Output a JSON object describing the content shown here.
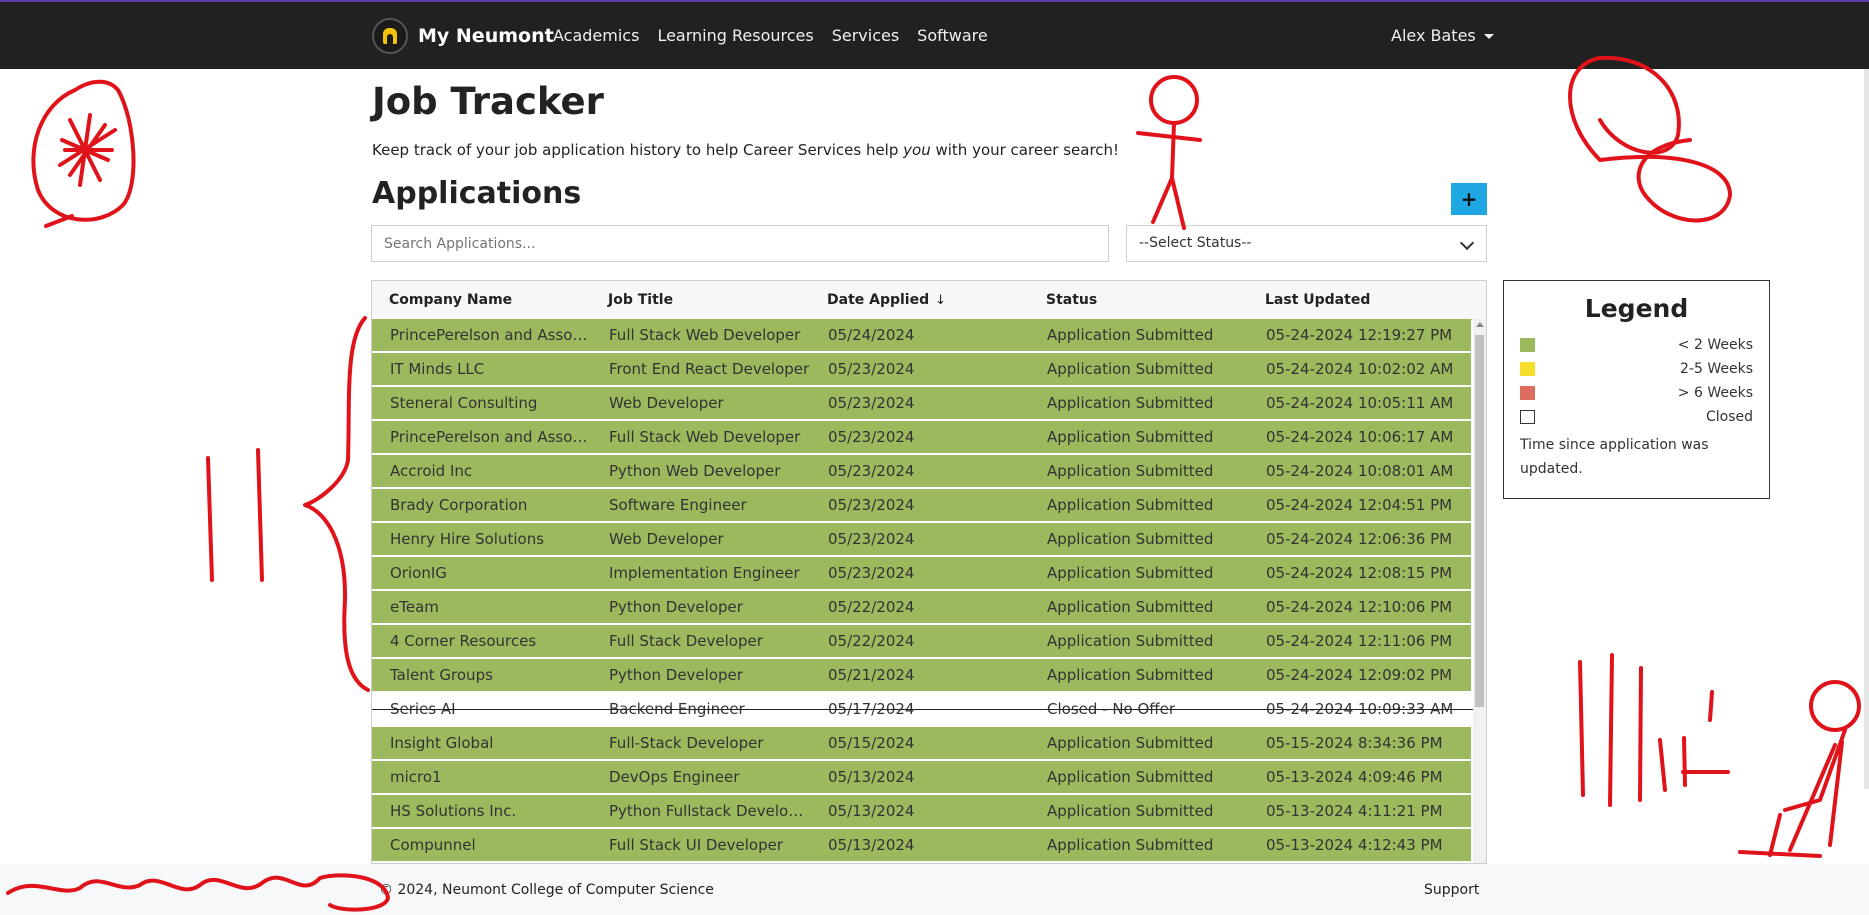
{
  "nav": {
    "brand": "My Neumont",
    "links": [
      "Academics",
      "Learning Resources",
      "Services",
      "Software"
    ],
    "user": "Alex Bates"
  },
  "header": {
    "title": "Job Tracker",
    "subtitle_before": "Keep track of your job application history to help Career Services help ",
    "subtitle_em": "you",
    "subtitle_after": " with your career search!"
  },
  "applications": {
    "heading": "Applications",
    "add_label": "+",
    "search_placeholder": "Search Applications...",
    "status_select": "--Select Status--",
    "sort_arrow": "↓",
    "columns": [
      "Company Name",
      "Job Title",
      "Date Applied",
      "Status",
      "Last Updated"
    ],
    "rows": [
      {
        "company": "PrincePerelson and Associates",
        "title": "Full Stack Web Developer",
        "date": "05/24/2024",
        "status": "Application Submitted",
        "updated": "05-24-2024 12:19:27 PM",
        "closed": false
      },
      {
        "company": "IT Minds LLC",
        "title": "Front End React Developer",
        "date": "05/23/2024",
        "status": "Application Submitted",
        "updated": "05-24-2024 10:02:02 AM",
        "closed": false
      },
      {
        "company": "Steneral Consulting",
        "title": "Web Developer",
        "date": "05/23/2024",
        "status": "Application Submitted",
        "updated": "05-24-2024 10:05:11 AM",
        "closed": false
      },
      {
        "company": "PrincePerelson and Associates",
        "title": "Full Stack Web Developer",
        "date": "05/23/2024",
        "status": "Application Submitted",
        "updated": "05-24-2024 10:06:17 AM",
        "closed": false
      },
      {
        "company": "Accroid Inc",
        "title": "Python Web Developer",
        "date": "05/23/2024",
        "status": "Application Submitted",
        "updated": "05-24-2024 10:08:01 AM",
        "closed": false
      },
      {
        "company": "Brady Corporation",
        "title": "Software Engineer",
        "date": "05/23/2024",
        "status": "Application Submitted",
        "updated": "05-24-2024 12:04:51 PM",
        "closed": false
      },
      {
        "company": "Henry Hire Solutions",
        "title": "Web Developer",
        "date": "05/23/2024",
        "status": "Application Submitted",
        "updated": "05-24-2024 12:06:36 PM",
        "closed": false
      },
      {
        "company": "OrionIG",
        "title": "Implementation Engineer",
        "date": "05/23/2024",
        "status": "Application Submitted",
        "updated": "05-24-2024 12:08:15 PM",
        "closed": false
      },
      {
        "company": "eTeam",
        "title": "Python Developer",
        "date": "05/22/2024",
        "status": "Application Submitted",
        "updated": "05-24-2024 12:10:06 PM",
        "closed": false
      },
      {
        "company": "4 Corner Resources",
        "title": "Full Stack Developer",
        "date": "05/22/2024",
        "status": "Application Submitted",
        "updated": "05-24-2024 12:11:06 PM",
        "closed": false
      },
      {
        "company": "Talent Groups",
        "title": "Python Developer",
        "date": "05/21/2024",
        "status": "Application Submitted",
        "updated": "05-24-2024 12:09:02 PM",
        "closed": false
      },
      {
        "company": "Series AI",
        "title": "Backend Engineer",
        "date": "05/17/2024",
        "status": "Closed - No Offer",
        "updated": "05-24-2024 10:09:33 AM",
        "closed": true
      },
      {
        "company": "Insight Global",
        "title": "Full-Stack Developer",
        "date": "05/15/2024",
        "status": "Application Submitted",
        "updated": "05-15-2024 8:34:36 PM",
        "closed": false
      },
      {
        "company": "micro1",
        "title": "DevOps Engineer",
        "date": "05/13/2024",
        "status": "Application Submitted",
        "updated": "05-13-2024 4:09:46 PM",
        "closed": false
      },
      {
        "company": "HS Solutions Inc.",
        "title": "Python Fullstack Developer",
        "date": "05/13/2024",
        "status": "Application Submitted",
        "updated": "05-13-2024 4:11:21 PM",
        "closed": false
      },
      {
        "company": "Compunnel",
        "title": "Full Stack UI Developer",
        "date": "05/13/2024",
        "status": "Application Submitted",
        "updated": "05-13-2024 4:12:43 PM",
        "closed": false
      }
    ]
  },
  "legend": {
    "title": "Legend",
    "items": [
      {
        "label": "< 2 Weeks",
        "color": "#9cb95e"
      },
      {
        "label": "2-5 Weeks",
        "color": "#f6df2a"
      },
      {
        "label": "> 6 Weeks",
        "color": "#dd6e5f"
      },
      {
        "label": "Closed",
        "color": "#ffffff"
      }
    ],
    "note": "Time since application was updated."
  },
  "footer": {
    "copyright": "© 2024, Neumont College of Computer Science",
    "support": "Support"
  },
  "colors": {
    "navbar": "#212121",
    "accent": "#1ea7e2",
    "row_recent": "#9cb95e",
    "doodle": "#e0131a"
  }
}
